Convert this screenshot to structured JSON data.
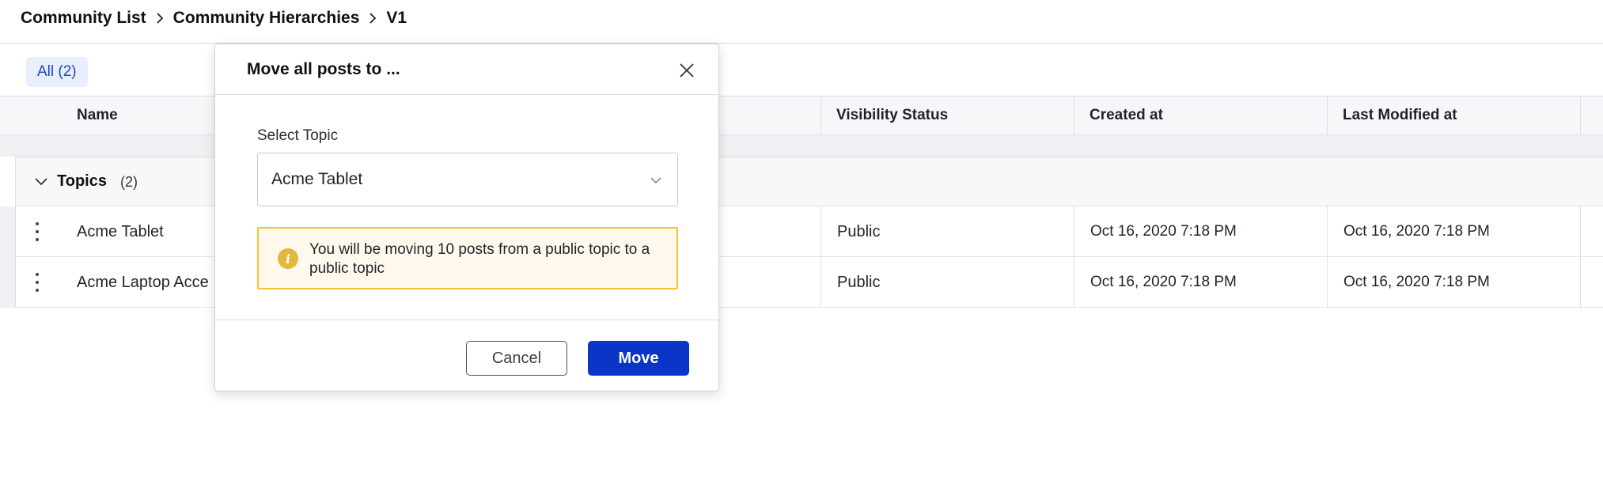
{
  "breadcrumb": {
    "items": [
      "Community List",
      "Community Hierarchies",
      "V1"
    ]
  },
  "filter": {
    "all_label": "All (2)"
  },
  "table": {
    "columns": {
      "name": "Name",
      "visibility": "Visibility Status",
      "created": "Created at",
      "modified": "Last Modified at"
    },
    "group": {
      "title": "Topics",
      "count": "(2)"
    },
    "rows": [
      {
        "name": "Acme Tablet",
        "visibility": "Public",
        "created": "Oct 16, 2020 7:18 PM",
        "modified": "Oct 16, 2020 7:18 PM"
      },
      {
        "name": "Acme Laptop Acce",
        "visibility": "Public",
        "created": "Oct 16, 2020 7:18 PM",
        "modified": "Oct 16, 2020 7:18 PM"
      }
    ]
  },
  "modal": {
    "title": "Move all posts to ...",
    "field_label": "Select Topic",
    "selected": "Acme Tablet",
    "alert": "You will be moving 10 posts from a public topic to a public topic",
    "cancel_label": "Cancel",
    "move_label": "Move"
  },
  "colors": {
    "primary": "#0a35c7",
    "warning_border": "#f2c332",
    "warning_bg": "#fef9ec",
    "chip_bg": "#e8eefc"
  }
}
